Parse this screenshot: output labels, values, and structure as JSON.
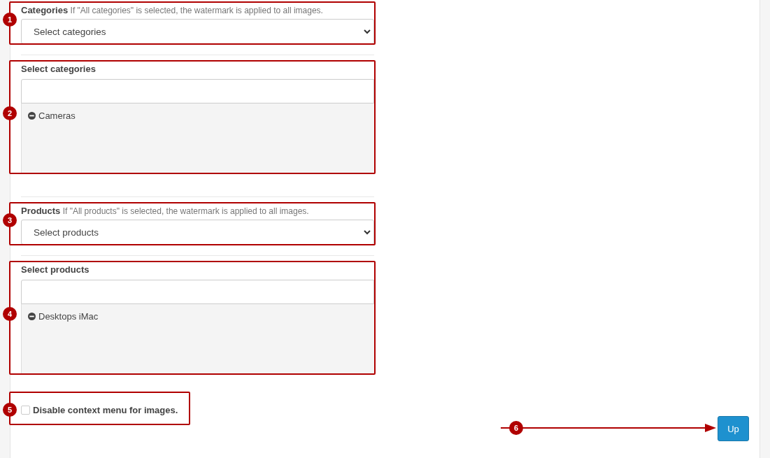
{
  "sections": [
    {
      "kind": "select",
      "marker": "1",
      "label": "Categories",
      "hint": "If \"All categories\" is selected, the watermark is applied to all images.",
      "value": "Select categories"
    },
    {
      "kind": "picker",
      "marker": "2",
      "label": "Select categories",
      "items": [
        "Cameras"
      ]
    },
    {
      "kind": "select",
      "marker": "3",
      "label": "Products",
      "hint": "If \"All products\" is selected, the watermark is applied to all images.",
      "value": "Select products"
    },
    {
      "kind": "picker",
      "marker": "4",
      "label": "Select products",
      "items": [
        "Desktops iMac"
      ]
    },
    {
      "kind": "checkbox",
      "marker": "5",
      "label": "Disable context menu for images.",
      "checked": false
    }
  ],
  "button": {
    "label": "Up",
    "marker": "6"
  }
}
